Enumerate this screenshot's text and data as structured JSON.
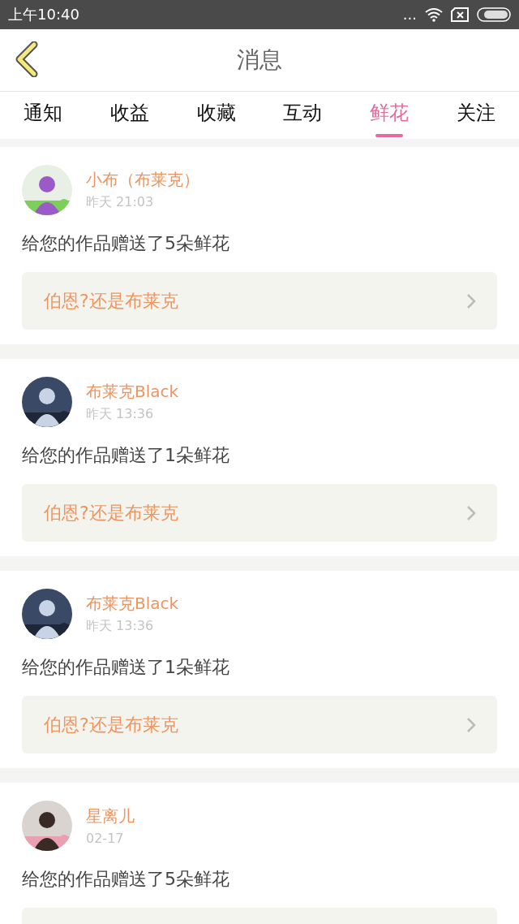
{
  "status_bar": {
    "time": "上午10:40",
    "dots": "..."
  },
  "header": {
    "title": "消息"
  },
  "tabs": [
    {
      "label": "通知",
      "selected": false
    },
    {
      "label": "收益",
      "selected": false
    },
    {
      "label": "收藏",
      "selected": false
    },
    {
      "label": "互动",
      "selected": false
    },
    {
      "label": "鲜花",
      "selected": true
    },
    {
      "label": "关注",
      "selected": false
    }
  ],
  "messages": [
    {
      "name": "小布（布莱克）",
      "time": "昨天 21:03",
      "text": "给您的作品赠送了5朵鲜花",
      "work": "伯恩?还是布莱克"
    },
    {
      "name": "布莱克Black",
      "time": "昨天 13:36",
      "text": "给您的作品赠送了1朵鲜花",
      "work": "伯恩?还是布莱克"
    },
    {
      "name": "布莱克Black",
      "time": "昨天 13:36",
      "text": "给您的作品赠送了1朵鲜花",
      "work": "伯恩?还是布莱克"
    },
    {
      "name": "星离儿",
      "time": "02-17",
      "text": "给您的作品赠送了5朵鲜花"
    }
  ]
}
